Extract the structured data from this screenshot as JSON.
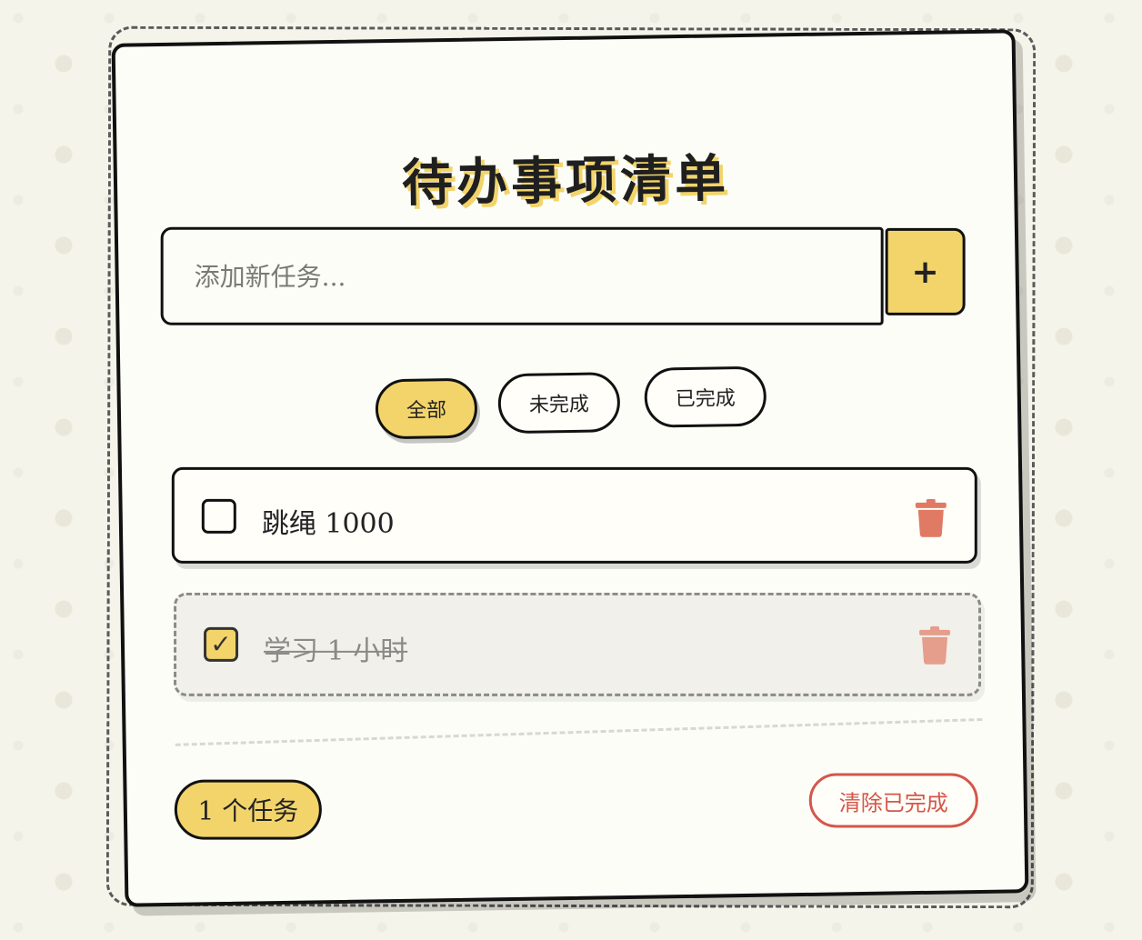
{
  "title": "待办事项清单",
  "new_task": {
    "placeholder": "添加新任务...",
    "value": "",
    "add_label": "+"
  },
  "filters": [
    {
      "label": "全部",
      "active": true
    },
    {
      "label": "未完成",
      "active": false
    },
    {
      "label": "已完成",
      "active": false
    }
  ],
  "tasks": [
    {
      "text": "跳绳 1000",
      "done": false,
      "check_mark": ""
    },
    {
      "text": "学习 1 小时",
      "done": true,
      "check_mark": "✓"
    }
  ],
  "footer": {
    "count_label": "1 个任务",
    "clear_label": "清除已完成"
  },
  "colors": {
    "accent": "#f2d46b",
    "danger": "#d4564a",
    "trash": "#e07a64",
    "background": "#f5f4ea"
  },
  "icons": {
    "delete": "trash-icon",
    "add": "plus-icon",
    "check": "checkmark-icon"
  }
}
